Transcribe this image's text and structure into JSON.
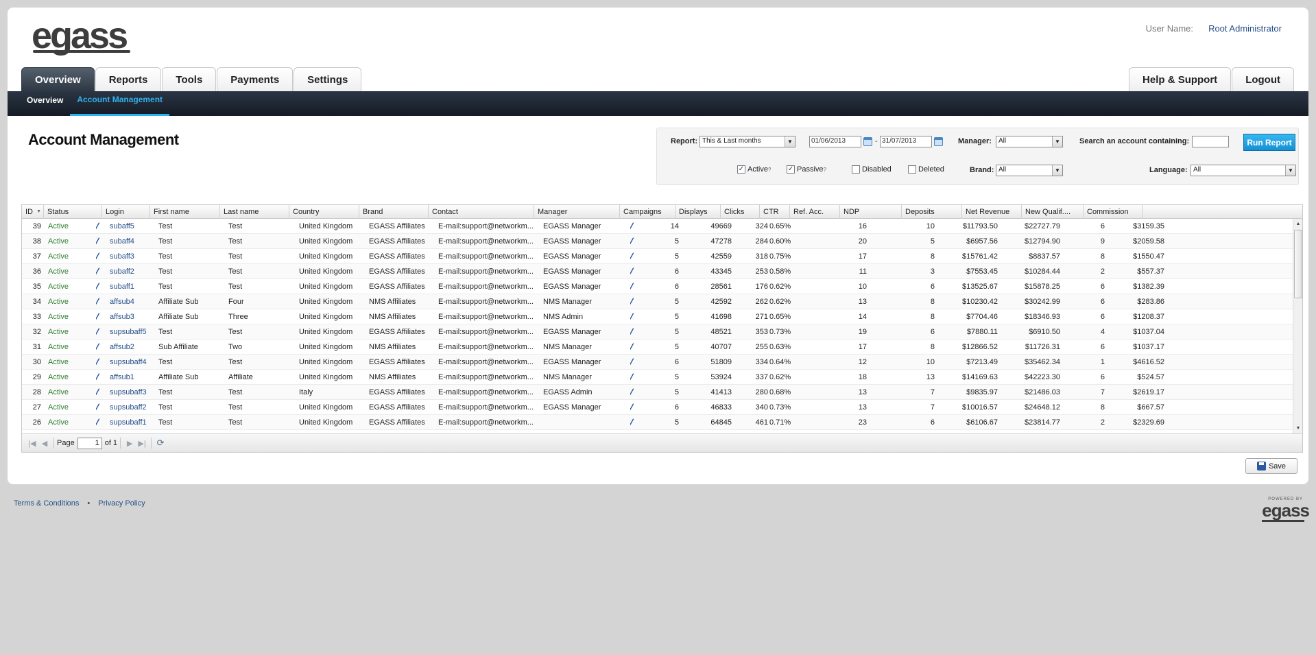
{
  "brand": {
    "logo_text": "egass",
    "powered_by": "POWERED BY",
    "powered_logo": "egass"
  },
  "user": {
    "label": "User Name:",
    "name": "Root Administrator"
  },
  "main_tabs": [
    {
      "label": "Overview",
      "active": true
    },
    {
      "label": "Reports"
    },
    {
      "label": "Tools"
    },
    {
      "label": "Payments"
    },
    {
      "label": "Settings"
    }
  ],
  "right_tabs": [
    {
      "label": "Help & Support"
    },
    {
      "label": "Logout"
    }
  ],
  "sub_tabs": [
    {
      "label": "Overview"
    },
    {
      "label": "Account Management",
      "active": true
    }
  ],
  "page_title": "Account Management",
  "filters": {
    "report_label": "Report:",
    "report_value": "This & Last months",
    "date_from": "01/06/2013",
    "date_sep": "-",
    "date_to": "31/07/2013",
    "manager_label": "Manager:",
    "manager_value": "All",
    "search_label": "Search an account containing:",
    "search_value": "",
    "run_button": "Run Report",
    "active_label": "Active",
    "passive_label": "Passive",
    "disabled_label": "Disabled",
    "deleted_label": "Deleted",
    "help_mark": "?",
    "brand_label": "Brand:",
    "brand_value": "All",
    "language_label": "Language:",
    "language_value": "All",
    "active_checked": true,
    "passive_checked": true,
    "disabled_checked": false,
    "deleted_checked": false
  },
  "columns": [
    "ID",
    "Status",
    "Login",
    "First name",
    "Last name",
    "Country",
    "Brand",
    "Contact",
    "Manager",
    "Campaigns",
    "Displays",
    "Clicks",
    "CTR",
    "Ref. Acc.",
    "NDP",
    "Deposits",
    "Net Revenue",
    "New Qualif....",
    "Commission"
  ],
  "rows": [
    [
      "39",
      "Active",
      "subaff5",
      "Test",
      "Test",
      "United Kingdom",
      "EGASS Affiliates",
      "E-mail:support@networkm...",
      "EGASS Manager",
      "14",
      "49669",
      "324",
      "0.65%",
      "16",
      "10",
      "$11793.50",
      "$22727.79",
      "6",
      "$3159.35"
    ],
    [
      "38",
      "Active",
      "subaff4",
      "Test",
      "Test",
      "United Kingdom",
      "EGASS Affiliates",
      "E-mail:support@networkm...",
      "EGASS Manager",
      "5",
      "47278",
      "284",
      "0.60%",
      "20",
      "5",
      "$6957.56",
      "$12794.90",
      "9",
      "$2059.58"
    ],
    [
      "37",
      "Active",
      "subaff3",
      "Test",
      "Test",
      "United Kingdom",
      "EGASS Affiliates",
      "E-mail:support@networkm...",
      "EGASS Manager",
      "5",
      "42559",
      "318",
      "0.75%",
      "17",
      "8",
      "$15761.42",
      "$8837.57",
      "8",
      "$1550.47"
    ],
    [
      "36",
      "Active",
      "subaff2",
      "Test",
      "Test",
      "United Kingdom",
      "EGASS Affiliates",
      "E-mail:support@networkm...",
      "EGASS Manager",
      "6",
      "43345",
      "253",
      "0.58%",
      "11",
      "3",
      "$7553.45",
      "$10284.44",
      "2",
      "$557.37"
    ],
    [
      "35",
      "Active",
      "subaff1",
      "Test",
      "Test",
      "United Kingdom",
      "EGASS Affiliates",
      "E-mail:support@networkm...",
      "EGASS Manager",
      "6",
      "28561",
      "176",
      "0.62%",
      "10",
      "6",
      "$13525.67",
      "$15878.25",
      "6",
      "$1382.39"
    ],
    [
      "34",
      "Active",
      "affsub4",
      "Affiliate Sub",
      "Four",
      "United Kingdom",
      "NMS Affiliates",
      "E-mail:support@networkm...",
      "NMS Manager",
      "5",
      "42592",
      "262",
      "0.62%",
      "13",
      "8",
      "$10230.42",
      "$30242.99",
      "6",
      "$283.86"
    ],
    [
      "33",
      "Active",
      "affsub3",
      "Affiliate Sub",
      "Three",
      "United Kingdom",
      "NMS Affiliates",
      "E-mail:support@networkm...",
      "NMS Admin",
      "5",
      "41698",
      "271",
      "0.65%",
      "14",
      "8",
      "$7704.46",
      "$18346.93",
      "6",
      "$1208.37"
    ],
    [
      "32",
      "Active",
      "supsubaff5",
      "Test",
      "Test",
      "United Kingdom",
      "EGASS Affiliates",
      "E-mail:support@networkm...",
      "EGASS Manager",
      "5",
      "48521",
      "353",
      "0.73%",
      "19",
      "6",
      "$7880.11",
      "$6910.50",
      "4",
      "$1037.04"
    ],
    [
      "31",
      "Active",
      "affsub2",
      "Sub Affiliate",
      "Two",
      "United Kingdom",
      "NMS Affiliates",
      "E-mail:support@networkm...",
      "NMS Manager",
      "5",
      "40707",
      "255",
      "0.63%",
      "17",
      "8",
      "$12866.52",
      "$11726.31",
      "6",
      "$1037.17"
    ],
    [
      "30",
      "Active",
      "supsubaff4",
      "Test",
      "Test",
      "United Kingdom",
      "EGASS Affiliates",
      "E-mail:support@networkm...",
      "EGASS Manager",
      "6",
      "51809",
      "334",
      "0.64%",
      "12",
      "10",
      "$7213.49",
      "$35462.34",
      "1",
      "$4616.52"
    ],
    [
      "29",
      "Active",
      "affsub1",
      "Affiliate Sub",
      "Affiliate",
      "United Kingdom",
      "NMS Affiliates",
      "E-mail:support@networkm...",
      "NMS Manager",
      "5",
      "53924",
      "337",
      "0.62%",
      "18",
      "13",
      "$14169.63",
      "$42223.30",
      "6",
      "$524.57"
    ],
    [
      "28",
      "Active",
      "supsubaff3",
      "Test",
      "Test",
      "Italy",
      "EGASS Affiliates",
      "E-mail:support@networkm...",
      "EGASS Admin",
      "5",
      "41413",
      "280",
      "0.68%",
      "13",
      "7",
      "$9835.97",
      "$21486.03",
      "7",
      "$2619.17"
    ],
    [
      "27",
      "Active",
      "supsubaff2",
      "Test",
      "Test",
      "United Kingdom",
      "EGASS Affiliates",
      "E-mail:support@networkm...",
      "EGASS Manager",
      "6",
      "46833",
      "340",
      "0.73%",
      "13",
      "7",
      "$10016.57",
      "$24648.12",
      "8",
      "$667.57"
    ],
    [
      "26",
      "Active",
      "supsubaff1",
      "Test",
      "Test",
      "United Kingdom",
      "EGASS Affiliates",
      "E-mail:support@networkm...",
      "",
      "5",
      "64845",
      "461",
      "0.71%",
      "23",
      "6",
      "$6106.67",
      "$23814.77",
      "2",
      "$2329.69"
    ]
  ],
  "pager": {
    "page_label": "Page",
    "page_value": "1",
    "of_label": "of 1"
  },
  "save_button": "Save",
  "footer": {
    "terms": "Terms & Conditions",
    "separator": "•",
    "privacy": "Privacy Policy"
  },
  "colors": {
    "accent": "#2fb1ec",
    "nav_dark": "#1c2430",
    "link": "#244f87",
    "status_green": "#2f7f2f"
  }
}
